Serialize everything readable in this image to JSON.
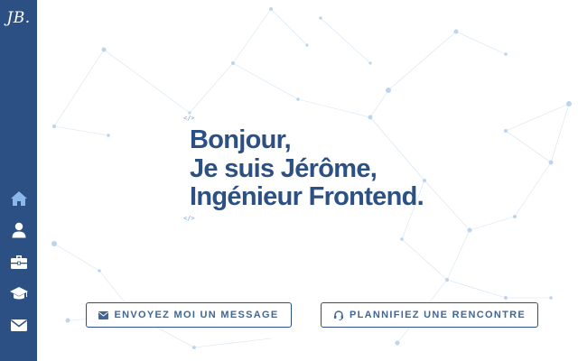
{
  "brand": {
    "logo_text": "JB."
  },
  "sidebar": {
    "items": [
      {
        "icon": "home-icon",
        "active": true
      },
      {
        "icon": "user-icon",
        "active": false
      },
      {
        "icon": "briefcase-icon",
        "active": false
      },
      {
        "icon": "graduation-cap-icon",
        "active": false
      },
      {
        "icon": "envelope-icon",
        "active": false
      }
    ]
  },
  "hero": {
    "tag_open": "</>",
    "line1": "Bonjour,",
    "line2": "Je suis Jérôme,",
    "line3_text": "Ingénieur Frontend",
    "line3_period": ".",
    "tag_close": "</>"
  },
  "actions": {
    "message_label": "ENVOYEZ MOI UN MESSAGE",
    "message_icon": "envelope-icon",
    "meeting_label": "PLANNIFIEZ UNE RENCONTRE",
    "meeting_icon": "headset-icon"
  },
  "colors": {
    "sidebar": "#2c5083",
    "active_icon": "#8ab8ec",
    "headline": "#2c5083",
    "button_text": "#3f6797",
    "network": "#a9c7ea"
  }
}
